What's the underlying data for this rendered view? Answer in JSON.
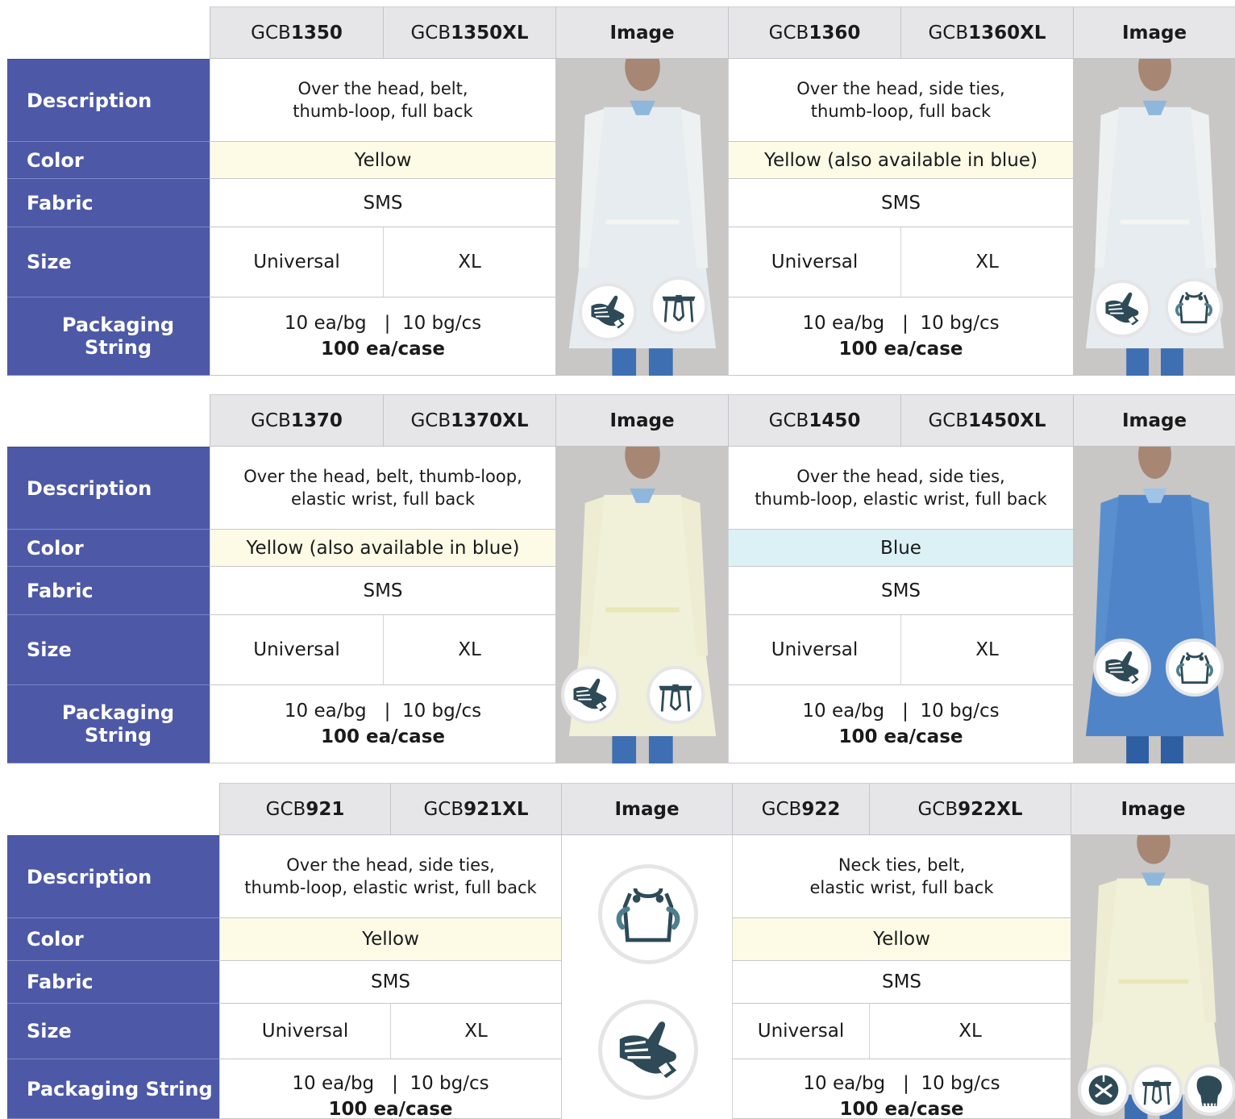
{
  "tables": [
    {
      "products": [
        {
          "code_prefix": "GCB",
          "code_num": "1350",
          "code_xl_prefix": "GCB",
          "code_xl_num": "1350XL",
          "description_1": "Over the head, belt,",
          "description_2": "thumb-loop, full back",
          "color": "Yellow",
          "fabric": "SMS",
          "size_a": "Universal",
          "size_b": "XL",
          "pack_1": "10 ea/bg   |  10 bg/cs",
          "pack_2": "100 ea/case"
        },
        {
          "code_prefix": "GCB",
          "code_num": "1360",
          "code_xl_prefix": "GCB",
          "code_xl_num": "1360XL",
          "description_1": "Over the head, side ties,",
          "description_2": "thumb-loop, full back",
          "color": "Yellow (also available in blue)",
          "fabric": "SMS",
          "size_a": "Universal",
          "size_b": "XL",
          "pack_1": "10 ea/bg   |  10 bg/cs",
          "pack_2": "100 ea/case"
        }
      ]
    },
    {
      "products": [
        {
          "code_prefix": "GCB",
          "code_num": "1370",
          "code_xl_prefix": "GCB",
          "code_xl_num": "1370XL",
          "description_1": "Over the head, belt, thumb-loop,",
          "description_2": "elastic wrist, full back",
          "color": "Yellow (also available in blue)",
          "fabric": "SMS",
          "size_a": "Universal",
          "size_b": "XL",
          "pack_1": "10 ea/bg   |  10 bg/cs",
          "pack_2": "100 ea/case"
        },
        {
          "code_prefix": "GCB",
          "code_num": "1450",
          "code_xl_prefix": "GCB",
          "code_xl_num": "1450XL",
          "description_1": "Over the head, side ties,",
          "description_2": "thumb-loop, elastic wrist, full back",
          "color": "Blue",
          "fabric": "SMS",
          "size_a": "Universal",
          "size_b": "XL",
          "pack_1": "10 ea/bg   |  10 bg/cs",
          "pack_2": "100 ea/case"
        }
      ]
    },
    {
      "products": [
        {
          "code_prefix": "GCB",
          "code_num": "921",
          "code_xl_prefix": "GCB",
          "code_xl_num": "921XL",
          "description_1": "Over the head, side ties,",
          "description_2": "thumb-loop, elastic wrist, full back",
          "color": "Yellow",
          "fabric": "SMS",
          "size_a": "Universal",
          "size_b": "XL",
          "pack_1": "10 ea/bg   |  10 bg/cs",
          "pack_2": "100 ea/case"
        },
        {
          "code_prefix": "GCB",
          "code_num": "922",
          "code_xl_prefix": "GCB",
          "code_xl_num": "922XL",
          "description_1": "Neck ties, belt,",
          "description_2": "elastic wrist, full back",
          "color": "Yellow",
          "fabric": "SMS",
          "size_a": "Universal",
          "size_b": "XL",
          "pack_1": "10 ea/bg   |  10 bg/cs",
          "pack_2": "100 ea/case"
        }
      ]
    }
  ],
  "labels": {
    "image": "Image",
    "description": "Description",
    "color": "Color",
    "fabric": "Fabric",
    "size": "Size",
    "packaging": "Packaging String"
  },
  "colors": {
    "label_bg": "#4d59a7",
    "header_bg": "#e6e6e8",
    "yellow_row": "#fdfbe6",
    "blue_row": "#dcf1f6",
    "icon_dark": "#2d4a56",
    "icon_teal": "#4e7f8c"
  },
  "icons": [
    "thumb-loop-icon",
    "belt-icon",
    "side-ties-icon",
    "neck-ties-icon",
    "elastic-wrist-icon"
  ]
}
